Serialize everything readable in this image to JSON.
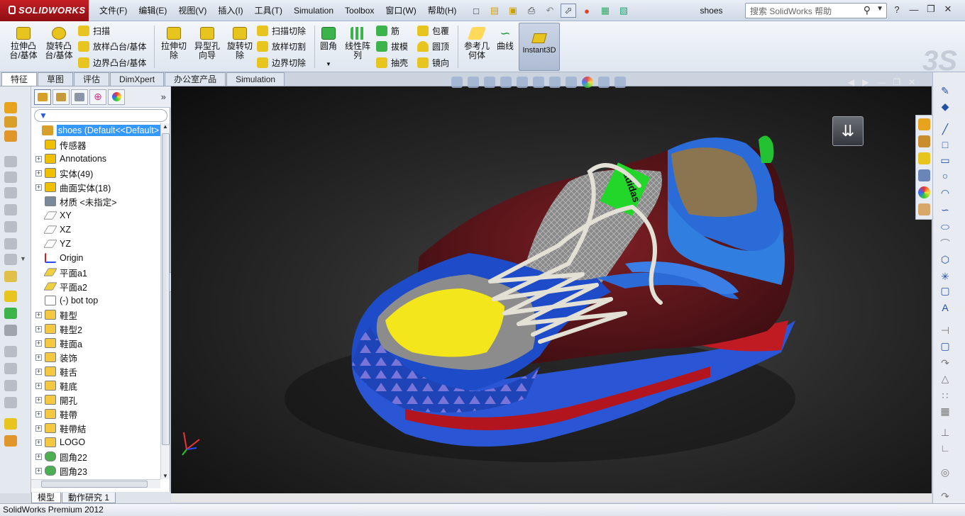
{
  "app": {
    "brand": "SOLIDWORKS",
    "document_title": "shoes",
    "status_text": "SolidWorks Premium 2012"
  },
  "menu": [
    "文件(F)",
    "编辑(E)",
    "视图(V)",
    "插入(I)",
    "工具(T)",
    "Simulation",
    "Toolbox",
    "窗口(W)",
    "帮助(H)"
  ],
  "help_search": {
    "placeholder": "搜索 SolidWorks 帮助"
  },
  "commands": {
    "extrude_boss": "拉伸凸\n台/基体",
    "revolve_boss": "旋转凸\n台/基体",
    "sweep": "扫描",
    "loft_boss": "放样凸台/基体",
    "boundary_boss": "边界凸台/基体",
    "extrude_cut": "拉伸切\n除",
    "hole_wizard": "异型孔\n向导",
    "revolve_cut": "旋转切\n除",
    "sweep_cut": "扫描切除",
    "loft_cut": "放样切割",
    "boundary_cut": "边界切除",
    "fillet": "圆角",
    "linear_pattern": "线性阵\n列",
    "rib": "筋",
    "draft": "拔模",
    "shell": "抽壳",
    "wrap": "包覆",
    "dome": "圆顶",
    "mirror": "镜向",
    "ref_geometry": "参考几\n何体",
    "curves": "曲线",
    "instant3d": "Instant3D"
  },
  "tabs": [
    "特征",
    "草图",
    "评估",
    "DimXpert",
    "办公室产品",
    "Simulation"
  ],
  "tree": {
    "root": "shoes  (Default<<Default>",
    "nodes": [
      {
        "label": "传感器",
        "expand": false,
        "icon": "sensor-icon",
        "color": "#f0c000"
      },
      {
        "label": "Annotations",
        "expand": true,
        "icon": "annotations-icon",
        "color": "#f0c000"
      },
      {
        "label": "实体(49)",
        "expand": true,
        "icon": "solid-bodies-icon",
        "color": "#f0c000"
      },
      {
        "label": "曲面实体(18)",
        "expand": true,
        "icon": "surface-bodies-icon",
        "color": "#f0c000"
      },
      {
        "label": "材质 <未指定>",
        "expand": false,
        "icon": "material-icon",
        "color": "#7a8a9a"
      },
      {
        "label": "XY",
        "expand": false,
        "icon": "plane-icon",
        "color": "#ffffff"
      },
      {
        "label": "XZ",
        "expand": false,
        "icon": "plane-icon",
        "color": "#ffffff"
      },
      {
        "label": "YZ",
        "expand": false,
        "icon": "plane-icon",
        "color": "#ffffff"
      },
      {
        "label": "Origin",
        "expand": false,
        "icon": "origin-icon",
        "color": "#cc2222"
      },
      {
        "label": "平面a1",
        "expand": false,
        "icon": "plane-icon",
        "color": "#f0d040"
      },
      {
        "label": "平面a2",
        "expand": false,
        "icon": "plane-icon",
        "color": "#f0d040"
      },
      {
        "label": "(-) bot top",
        "expand": false,
        "icon": "sketch-icon",
        "color": "#ffffff"
      },
      {
        "label": "鞋型",
        "expand": true,
        "icon": "folder-icon",
        "color": "#f5c842"
      },
      {
        "label": "鞋型2",
        "expand": true,
        "icon": "folder-icon",
        "color": "#f5c842"
      },
      {
        "label": "鞋面a",
        "expand": true,
        "icon": "folder-icon",
        "color": "#f5c842"
      },
      {
        "label": "装饰",
        "expand": true,
        "icon": "folder-icon",
        "color": "#f5c842"
      },
      {
        "label": "鞋舌",
        "expand": true,
        "icon": "folder-icon",
        "color": "#f5c842"
      },
      {
        "label": "鞋底",
        "expand": true,
        "icon": "folder-icon",
        "color": "#f5c842"
      },
      {
        "label": "開孔",
        "expand": true,
        "icon": "folder-icon",
        "color": "#f5c842"
      },
      {
        "label": "鞋帶",
        "expand": true,
        "icon": "folder-icon",
        "color": "#f5c842"
      },
      {
        "label": "鞋帶結",
        "expand": true,
        "icon": "folder-icon",
        "color": "#f5c842"
      },
      {
        "label": "LOGO",
        "expand": true,
        "icon": "folder-icon",
        "color": "#f5c842"
      },
      {
        "label": "圆角22",
        "expand": true,
        "icon": "fillet-feature-icon",
        "color": "#4caf50"
      },
      {
        "label": "圆角23",
        "expand": true,
        "icon": "fillet-feature-icon",
        "color": "#4caf50"
      }
    ]
  },
  "viewport": {
    "logo_text": "adidas"
  },
  "model_tabs": [
    "模型",
    "動作研究 1"
  ]
}
